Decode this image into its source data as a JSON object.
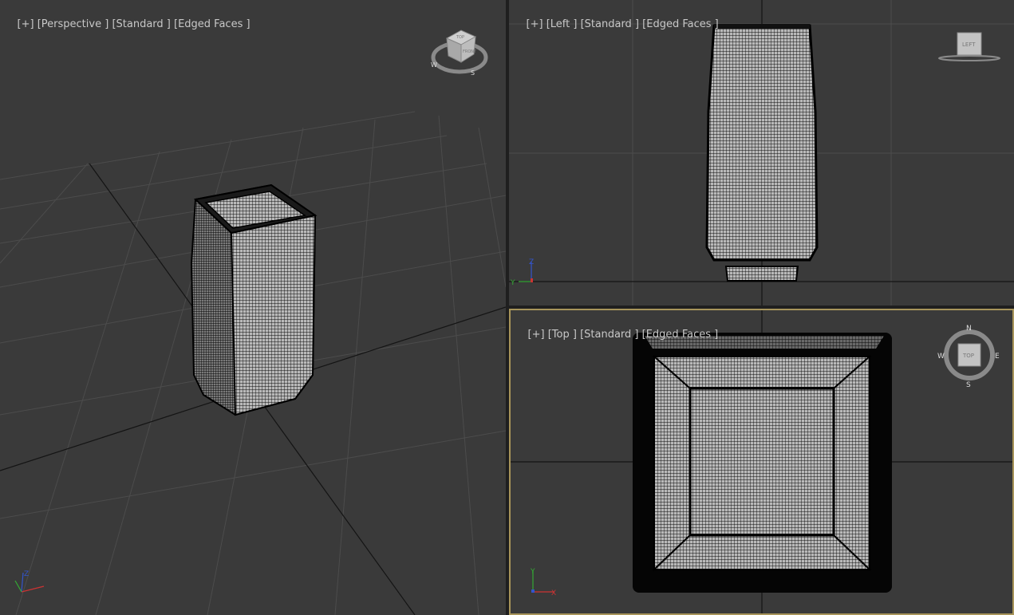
{
  "viewports": {
    "perspective": {
      "labels": {
        "plus": "[+]",
        "view": "[Perspective ]",
        "shading": "[Standard ]",
        "mode": "[Edged Faces ]"
      },
      "viewcube": {
        "top": "TOP",
        "front": "FRONT",
        "compass": [
          "W",
          "S"
        ]
      },
      "axis": {
        "z": "Z"
      }
    },
    "left": {
      "labels": {
        "plus": "[+]",
        "view": "[Left ]",
        "shading": "[Standard ]",
        "mode": "[Edged Faces ]"
      },
      "viewcube": {
        "face": "LEFT"
      },
      "axis": {
        "z": "Z",
        "y": "Y"
      }
    },
    "top": {
      "labels": {
        "plus": "[+]",
        "view": "[Top ]",
        "shading": "[Standard ]",
        "mode": "[Edged Faces ]"
      },
      "viewcube": {
        "face": "TOP",
        "compass": {
          "n": "N",
          "e": "E",
          "s": "S",
          "w": "W"
        }
      },
      "axis": {
        "y": "Y",
        "x": "X"
      },
      "active": true
    }
  },
  "colors": {
    "viewport_bg": "#3a3a3a",
    "grid": "#4a4a4a",
    "grid_axis": "#111111",
    "active_border": "#a8955a",
    "mesh_fill": "#b9b9b9",
    "mesh_lines": "#101010"
  }
}
